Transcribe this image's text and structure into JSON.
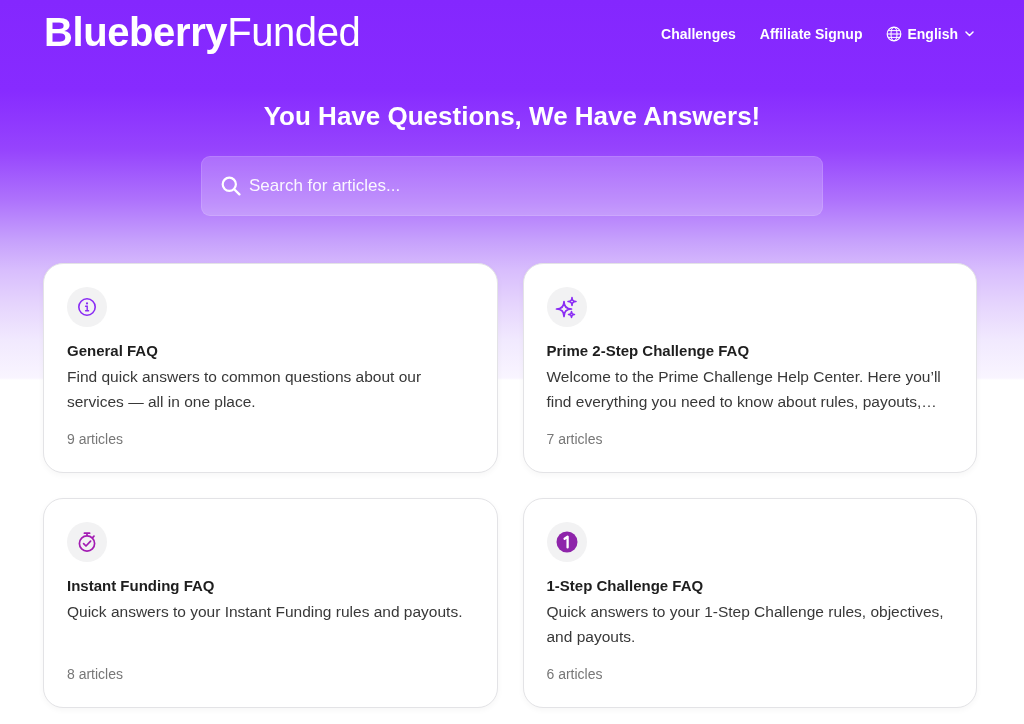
{
  "header": {
    "logo": "**Blueberry**Funded",
    "nav": [
      "Challenges",
      "Affiliate Signup"
    ],
    "language": "English"
  },
  "hero": {
    "title": "You Have Questions, We Have Answers!",
    "search": {
      "placeholder": "Search for articles..."
    }
  },
  "categories": [
    {
      "title": "General FAQ",
      "description": "Find quick answers to common questions about our services — all in one place.",
      "count": "9 articles"
    },
    {
      "title": "Prime 2-Step Challenge FAQ",
      "description": "Welcome to the Prime Challenge Help Center. Here you’ll find everything you need to know about rules, payouts,…",
      "count": "7 articles"
    },
    {
      "title": "Instant Funding FAQ",
      "description": "Quick answers to your Instant Funding rules and payouts.",
      "count": "8 articles"
    },
    {
      "title": "1-Step Challenge FAQ",
      "description": "Quick answers to your 1-Step Challenge rules, objectives, and payouts.",
      "count": "6 articles"
    }
  ]
}
